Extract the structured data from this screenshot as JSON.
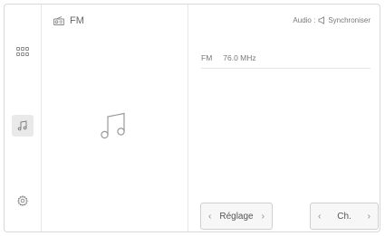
{
  "source": {
    "title": "FM"
  },
  "audio": {
    "label": "Audio :",
    "sync_label": "Synchroniser"
  },
  "station": {
    "band": "FM",
    "frequency": "76.0 MHz"
  },
  "buttons": {
    "tune": {
      "label": "Réglage",
      "prev": "‹",
      "next": "›"
    },
    "channel": {
      "label": "Ch.",
      "prev": "‹",
      "next": "›"
    }
  },
  "icons": {
    "rail_apps": "grid-icon",
    "rail_audio": "music-note-icon",
    "rail_settings": "gear-icon",
    "source": "radio-icon",
    "artwork": "music-note-icon",
    "sync": "speaker-icon"
  }
}
